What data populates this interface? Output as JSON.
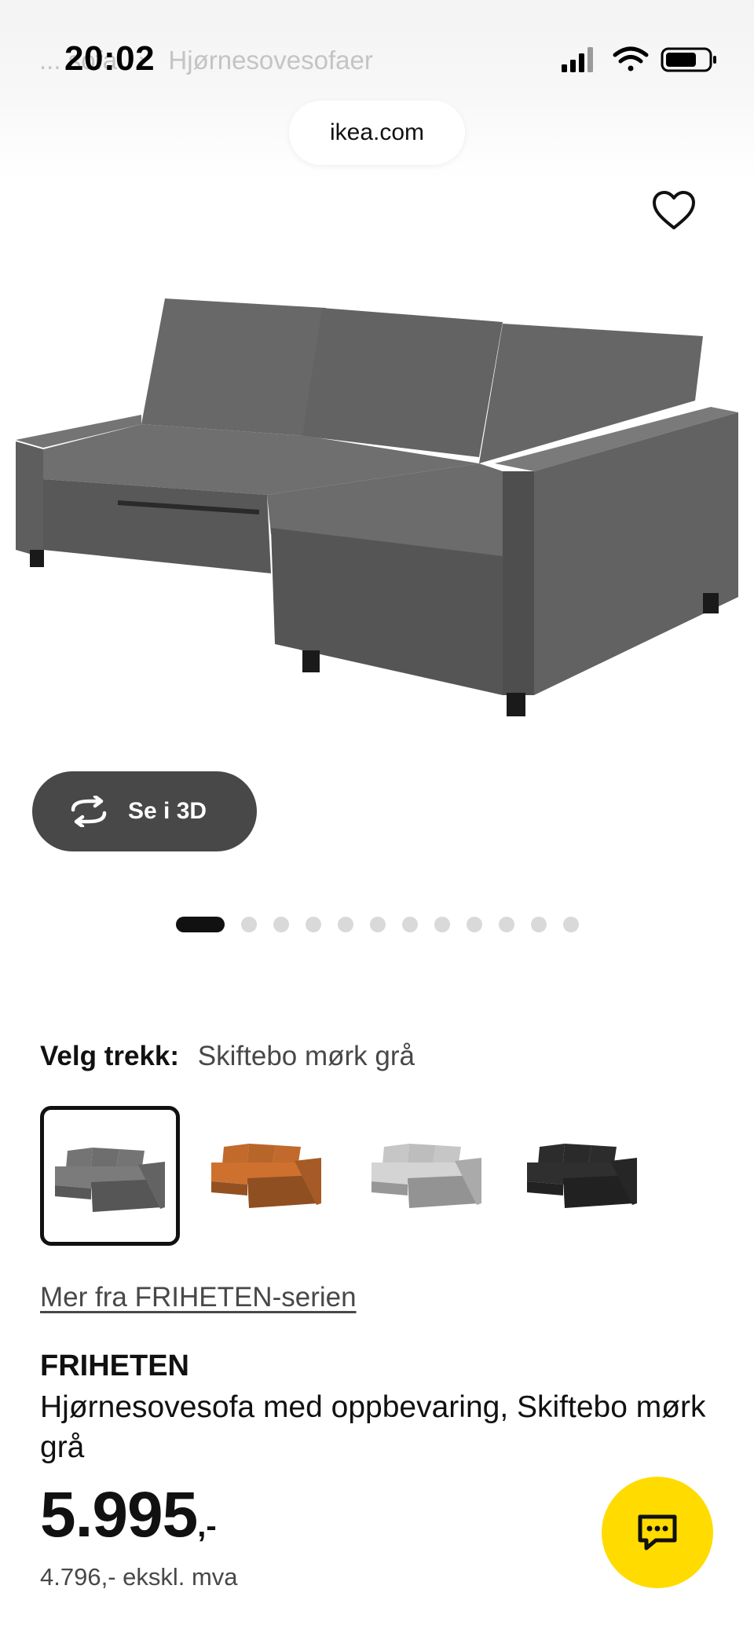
{
  "status_bar": {
    "time": "20:02"
  },
  "breadcrumb": {
    "items": [
      "...",
      "sofa",
      "Hjørnesovesofaer"
    ],
    "separator": "›"
  },
  "browser": {
    "url": "ikea.com"
  },
  "icons": {
    "favorite": "heart-icon",
    "view_3d": "rotate-3d-icon",
    "chat": "chat-bubble-icon",
    "signal": "cellular-signal-icon",
    "wifi": "wifi-icon",
    "battery": "battery-icon"
  },
  "gallery": {
    "view_3d_label": "Se i 3D",
    "image_count": 12,
    "active_index": 0
  },
  "cover": {
    "label": "Velg trekk:",
    "value": "Skiftebo mørk grå",
    "options": [
      {
        "color": "#6e6e6e",
        "selected": true
      },
      {
        "color": "#b8652a",
        "selected": false
      },
      {
        "color": "#bdbdbd",
        "selected": false
      },
      {
        "color": "#2a2a2a",
        "selected": false
      }
    ]
  },
  "series_link": "Mer fra FRIHETEN-serien",
  "product": {
    "name": "FRIHETEN",
    "description": "Hjørnesovesofa med oppbevaring, Skiftebo mørk grå",
    "price": "5.995",
    "price_suffix": ",-",
    "price_ex_vat": "4.796,- ekskl. mva"
  },
  "colors": {
    "accent_yellow": "#ffdb00",
    "button_dark": "#484848"
  }
}
